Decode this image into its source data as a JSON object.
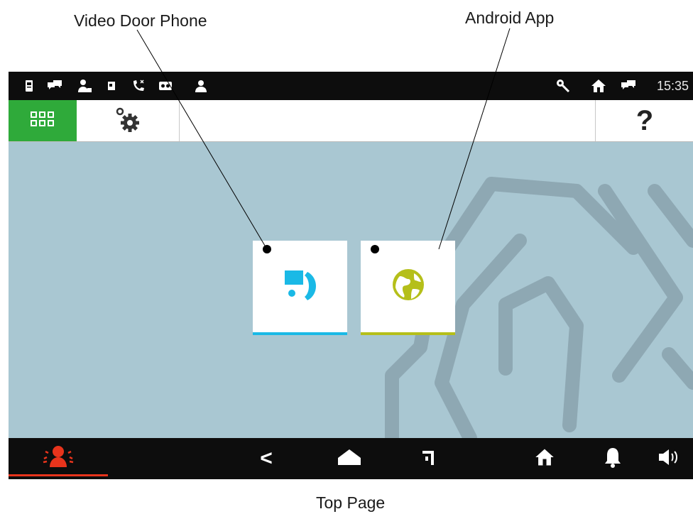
{
  "callouts": {
    "video_door_phone": "Video Door Phone",
    "android_app": "Android App",
    "caption": "Top Page"
  },
  "status_bar": {
    "left_icons": [
      "intercom-icon",
      "chat-icon",
      "user-lock-icon",
      "sim-icon",
      "missed-call-icon",
      "voicemail-icon",
      "contact-icon"
    ],
    "right_icons": [
      "wrench-icon",
      "home-icon",
      "chat-icon"
    ],
    "time": "15:35"
  },
  "toolbar": {
    "apps_icon": "apps-grid-icon",
    "settings_icon": "gear-icon",
    "help_label": "?"
  },
  "tiles": [
    {
      "name": "video-door-phone",
      "icon": "door-phone-icon",
      "accent": "#1ab9e6"
    },
    {
      "name": "android-app",
      "icon": "globe-icon",
      "accent": "#b5bf1a"
    }
  ],
  "nav_bar": {
    "emergency_icon": "alarm-person-icon",
    "back_label": "<",
    "icons": [
      "home-icon",
      "recents-icon",
      "home-icon",
      "bell-icon",
      "volume-icon"
    ]
  },
  "colors": {
    "status_bar": "#0d0d0d",
    "apps_active": "#2faa3a",
    "screen_background": "#a9c7d2",
    "emergency": "#e8341c"
  }
}
